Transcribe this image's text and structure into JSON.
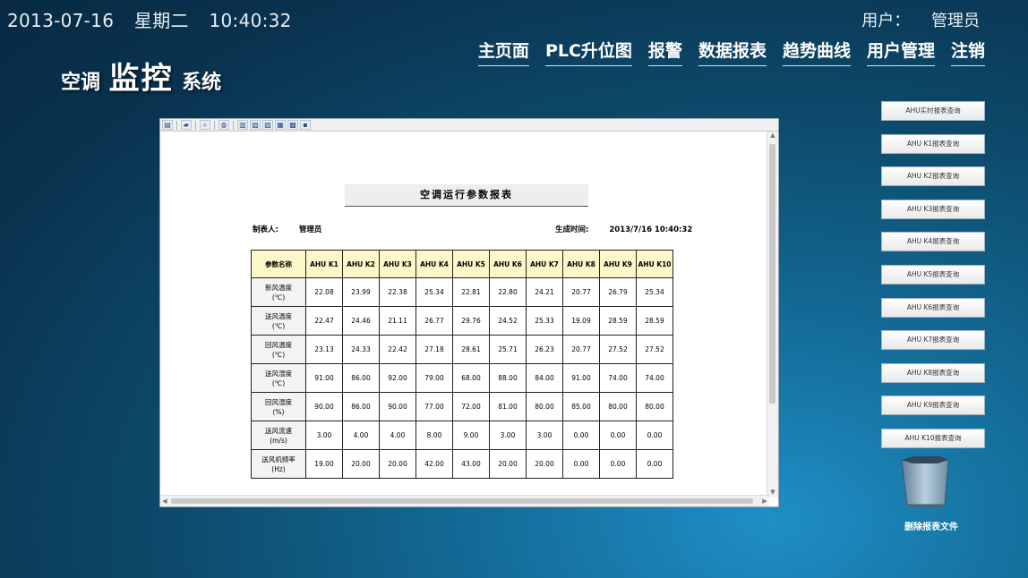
{
  "header": {
    "date": "2013-07-16",
    "weekday": "星期二",
    "time": "10:40:32",
    "user_label": "用户：",
    "user_name": "管理员"
  },
  "app_title": {
    "part1": "空调",
    "part2": "监控",
    "part3": "系统"
  },
  "nav": [
    "主页面",
    "PLC升位图",
    "报警",
    "数据报表",
    "趋势曲线",
    "用户管理",
    "注销"
  ],
  "toolbar_icons": [
    "page-icon",
    "open-folder-icon",
    "zoom-icon",
    "globe-icon",
    "print-icon",
    "export-icon",
    "find-icon",
    "save-icon"
  ],
  "report": {
    "title": "空调运行参数报表",
    "creator_label": "制表人:",
    "creator": "管理员",
    "generated_label": "生成时间:",
    "generated": "2013/7/16  10:40:32",
    "header_first": "参数名称",
    "columns": [
      "AHU K1",
      "AHU K2",
      "AHU K3",
      "AHU K4",
      "AHU K5",
      "AHU K6",
      "AHU K7",
      "AHU K8",
      "AHU K9",
      "AHU K10"
    ],
    "rows": [
      {
        "name": "新风温度",
        "unit": "(℃)",
        "values": [
          "22.08",
          "23.99",
          "22.38",
          "25.34",
          "22.81",
          "22.80",
          "24.21",
          "20.77",
          "26.79",
          "25.34"
        ]
      },
      {
        "name": "送风温度",
        "unit": "(℃)",
        "values": [
          "22.47",
          "24.46",
          "21.11",
          "26.77",
          "29.76",
          "24.52",
          "25.33",
          "19.09",
          "28.59",
          "28.59"
        ]
      },
      {
        "name": "回风温度",
        "unit": "(℃)",
        "values": [
          "23.13",
          "24.33",
          "22.42",
          "27.18",
          "28.61",
          "25.71",
          "26.23",
          "20.77",
          "27.52",
          "27.52"
        ]
      },
      {
        "name": "送风湿度",
        "unit": "(℃)",
        "values": [
          "91.00",
          "86.00",
          "92.00",
          "79.00",
          "68.00",
          "88.00",
          "84.00",
          "91.00",
          "74.00",
          "74.00"
        ]
      },
      {
        "name": "回风湿度",
        "unit": "(%)",
        "values": [
          "90.00",
          "86.00",
          "90.00",
          "77.00",
          "72.00",
          "81.00",
          "80.00",
          "85.00",
          "80.00",
          "80.00"
        ]
      },
      {
        "name": "送风流速",
        "unit": "(m/s)",
        "values": [
          "3.00",
          "4.00",
          "4.00",
          "8.00",
          "9.00",
          "3.00",
          "3.00",
          "0.00",
          "0.00",
          "0.00"
        ]
      },
      {
        "name": "送风机频率",
        "unit": "(Hz)",
        "values": [
          "19.00",
          "20.00",
          "20.00",
          "42.00",
          "43.00",
          "20.00",
          "20.00",
          "0.00",
          "0.00",
          "0.00"
        ]
      }
    ]
  },
  "sidebar": {
    "buttons": [
      "AHU实时报表查询",
      "AHU K1报表查询",
      "AHU K2报表查询",
      "AHU K3报表查询",
      "AHU K4报表查询",
      "AHU K5报表查询",
      "AHU K6报表查询",
      "AHU K7报表查询",
      "AHU K8报表查询",
      "AHU K9报表查询",
      "AHU K10报表查询"
    ],
    "delete_label": "删除报表文件"
  }
}
